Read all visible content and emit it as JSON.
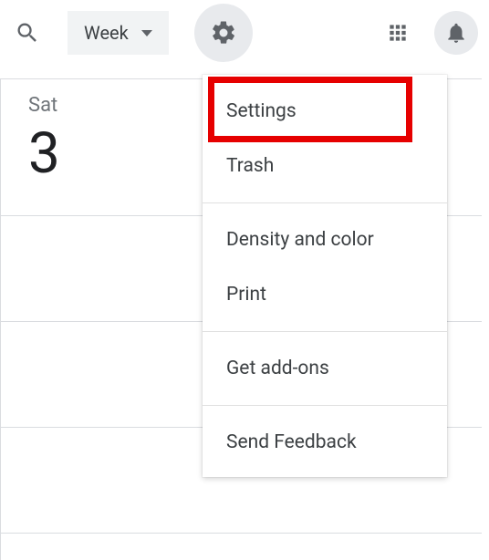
{
  "toolbar": {
    "view_label": "Week"
  },
  "day": {
    "name": "Sat",
    "number": "3"
  },
  "menu": {
    "settings": "Settings",
    "trash": "Trash",
    "density": "Density and color",
    "print": "Print",
    "addons": "Get add-ons",
    "feedback": "Send Feedback"
  }
}
